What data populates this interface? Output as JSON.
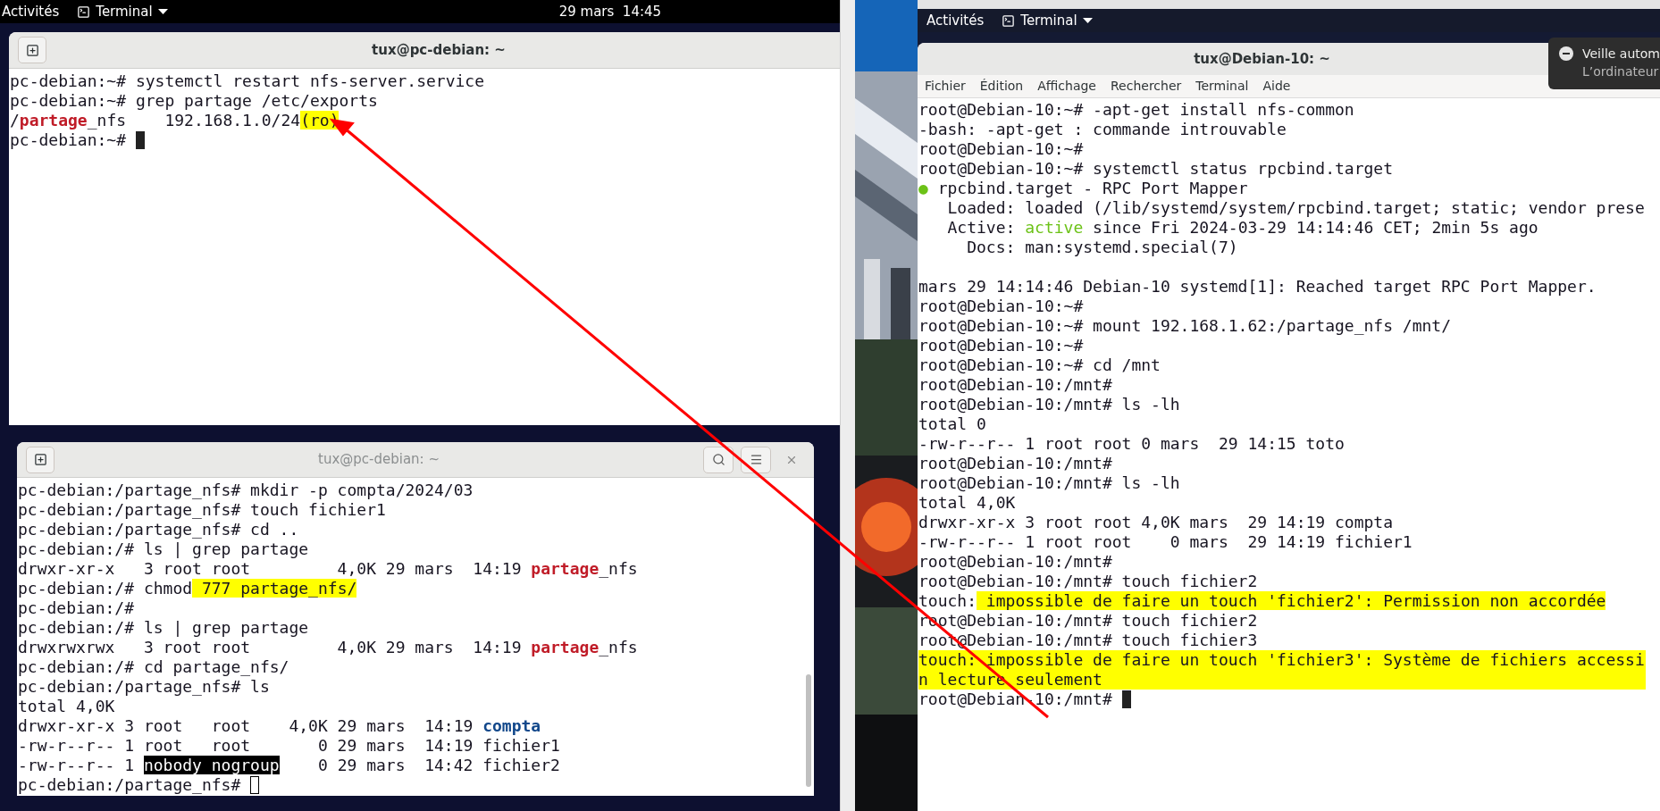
{
  "left_screen": {
    "top_bar": {
      "activities": "Activités",
      "app_menu": "Terminal",
      "clock": "29 mars  14:45"
    },
    "windows": [
      {
        "title": "tux@pc-debian: ~",
        "focused": true,
        "lines": [
          {
            "kind": "text",
            "text": "pc-debian:~# systemctl restart nfs-server.service"
          },
          {
            "kind": "text",
            "text": "pc-debian:~# grep partage /etc/exports"
          },
          {
            "kind": "mixed",
            "segments": [
              {
                "kind": "plain",
                "text": "/"
              },
              {
                "kind": "red",
                "text": "partage"
              },
              {
                "kind": "plain",
                "text": "_nfs    192.168.1.0/24"
              },
              {
                "kind": "highlight",
                "text": "(ro)"
              }
            ]
          },
          {
            "kind": "text",
            "text": "pc-debian:~# ",
            "cursor": true
          }
        ]
      },
      {
        "title": "tux@pc-debian: ~",
        "focused": false,
        "lines": [
          {
            "kind": "text",
            "text": "pc-debian:/partage_nfs# mkdir -p compta/2024/03"
          },
          {
            "kind": "text",
            "text": "pc-debian:/partage_nfs# touch fichier1"
          },
          {
            "kind": "text",
            "text": "pc-debian:/partage_nfs# cd .."
          },
          {
            "kind": "text",
            "text": "pc-debian:/# ls | grep partage"
          },
          {
            "kind": "mixed",
            "segments": [
              {
                "kind": "plain",
                "text": "drwxr-xr-x   3 root root         4,0K 29 mars  14:19 "
              },
              {
                "kind": "red",
                "text": "partage"
              },
              {
                "kind": "plain",
                "text": "_nfs"
              }
            ]
          },
          {
            "kind": "mixed",
            "segments": [
              {
                "kind": "plain",
                "text": "pc-debian:/# chmod"
              },
              {
                "kind": "highlight",
                "text": " 777 partage_nfs/"
              }
            ]
          },
          {
            "kind": "text",
            "text": "pc-debian:/#"
          },
          {
            "kind": "text",
            "text": "pc-debian:/# ls | grep partage"
          },
          {
            "kind": "mixed",
            "segments": [
              {
                "kind": "plain",
                "text": "drwxrwxrwx   3 root root         4,0K 29 mars  14:19 "
              },
              {
                "kind": "red",
                "text": "partage"
              },
              {
                "kind": "plain",
                "text": "_nfs"
              }
            ]
          },
          {
            "kind": "text",
            "text": "pc-debian:/# cd partage_nfs/"
          },
          {
            "kind": "text",
            "text": "pc-debian:/partage_nfs# ls"
          },
          {
            "kind": "text",
            "text": "total 4,0K"
          },
          {
            "kind": "mixed",
            "segments": [
              {
                "kind": "plain",
                "text": "drwxr-xr-x 3 root   root    4,0K 29 mars  14:19 "
              },
              {
                "kind": "blue",
                "text": "compta"
              }
            ]
          },
          {
            "kind": "text",
            "text": "-rw-r--r-- 1 root   root       0 29 mars  14:19 fichier1"
          },
          {
            "kind": "mixed",
            "segments": [
              {
                "kind": "plain",
                "text": "-rw-r--r-- 1 "
              },
              {
                "kind": "inverse",
                "text": "nobody nogroup"
              },
              {
                "kind": "plain",
                "text": "    0 29 mars  14:42 fichier2"
              }
            ]
          },
          {
            "kind": "text",
            "text": "pc-debian:/partage_nfs# ",
            "cursor": true
          }
        ]
      }
    ]
  },
  "right_screen": {
    "top_bar": {
      "activities": "Activités",
      "app_menu": "Terminal"
    },
    "notification": {
      "title": "Veille autom",
      "body": "L’ordinateur"
    },
    "window": {
      "title": "tux@Debian-10: ~",
      "focused": true,
      "menu": [
        "Fichier",
        "Édition",
        "Affichage",
        "Rechercher",
        "Terminal",
        "Aide"
      ],
      "lines": [
        {
          "kind": "text",
          "text": "root@Debian-10:~# -apt-get install nfs-common"
        },
        {
          "kind": "text",
          "text": "-bash: -apt-get : commande introuvable"
        },
        {
          "kind": "text",
          "text": "root@Debian-10:~#"
        },
        {
          "kind": "text",
          "text": "root@Debian-10:~# systemctl status rpcbind.target"
        },
        {
          "kind": "mixed",
          "segments": [
            {
              "kind": "green",
              "text": "●"
            },
            {
              "kind": "plain",
              "text": " rpcbind.target - RPC Port Mapper"
            }
          ]
        },
        {
          "kind": "text",
          "text": "   Loaded: loaded (/lib/systemd/system/rpcbind.target; static; vendor prese"
        },
        {
          "kind": "mixed",
          "segments": [
            {
              "kind": "plain",
              "text": "   Active: "
            },
            {
              "kind": "green",
              "text": "active"
            },
            {
              "kind": "plain",
              "text": " since Fri 2024-03-29 14:14:46 CET; 2min 5s ago"
            }
          ]
        },
        {
          "kind": "text",
          "text": "     Docs: man:systemd.special(7)"
        },
        {
          "kind": "blank"
        },
        {
          "kind": "text",
          "text": "mars 29 14:14:46 Debian-10 systemd[1]: Reached target RPC Port Mapper."
        },
        {
          "kind": "text",
          "text": "root@Debian-10:~#"
        },
        {
          "kind": "text",
          "text": "root@Debian-10:~# mount 192.168.1.62:/partage_nfs /mnt/"
        },
        {
          "kind": "text",
          "text": "root@Debian-10:~#"
        },
        {
          "kind": "text",
          "text": "root@Debian-10:~# cd /mnt"
        },
        {
          "kind": "text",
          "text": "root@Debian-10:/mnt#"
        },
        {
          "kind": "text",
          "text": "root@Debian-10:/mnt# ls -lh"
        },
        {
          "kind": "text",
          "text": "total 0"
        },
        {
          "kind": "text",
          "text": "-rw-r--r-- 1 root root 0 mars  29 14:15 toto"
        },
        {
          "kind": "text",
          "text": "root@Debian-10:/mnt#"
        },
        {
          "kind": "text",
          "text": "root@Debian-10:/mnt# ls -lh"
        },
        {
          "kind": "text",
          "text": "total 4,0K"
        },
        {
          "kind": "text",
          "text": "drwxr-xr-x 3 root root 4,0K mars  29 14:19 compta"
        },
        {
          "kind": "text",
          "text": "-rw-r--r-- 1 root root    0 mars  29 14:19 fichier1"
        },
        {
          "kind": "text",
          "text": "root@Debian-10:/mnt#"
        },
        {
          "kind": "text",
          "text": "root@Debian-10:/mnt# touch fichier2"
        },
        {
          "kind": "mixed",
          "segments": [
            {
              "kind": "plain",
              "text": "touch:"
            },
            {
              "kind": "highlight",
              "text": " impossible de faire un touch 'fichier2': Permission non accordée"
            }
          ]
        },
        {
          "kind": "text",
          "text": "root@Debian-10:/mnt# touch fichier2"
        },
        {
          "kind": "text",
          "text": "root@Debian-10:/mnt# touch fichier3"
        },
        {
          "kind": "text",
          "text": "touch: impossible de faire un touch 'fichier3': Système de fichiers accessi",
          "highlight": true
        },
        {
          "kind": "text",
          "text": "n lecture seulement",
          "highlight": true
        },
        {
          "kind": "text",
          "text": "root@Debian-10:/mnt# ",
          "cursor": true
        }
      ]
    }
  }
}
